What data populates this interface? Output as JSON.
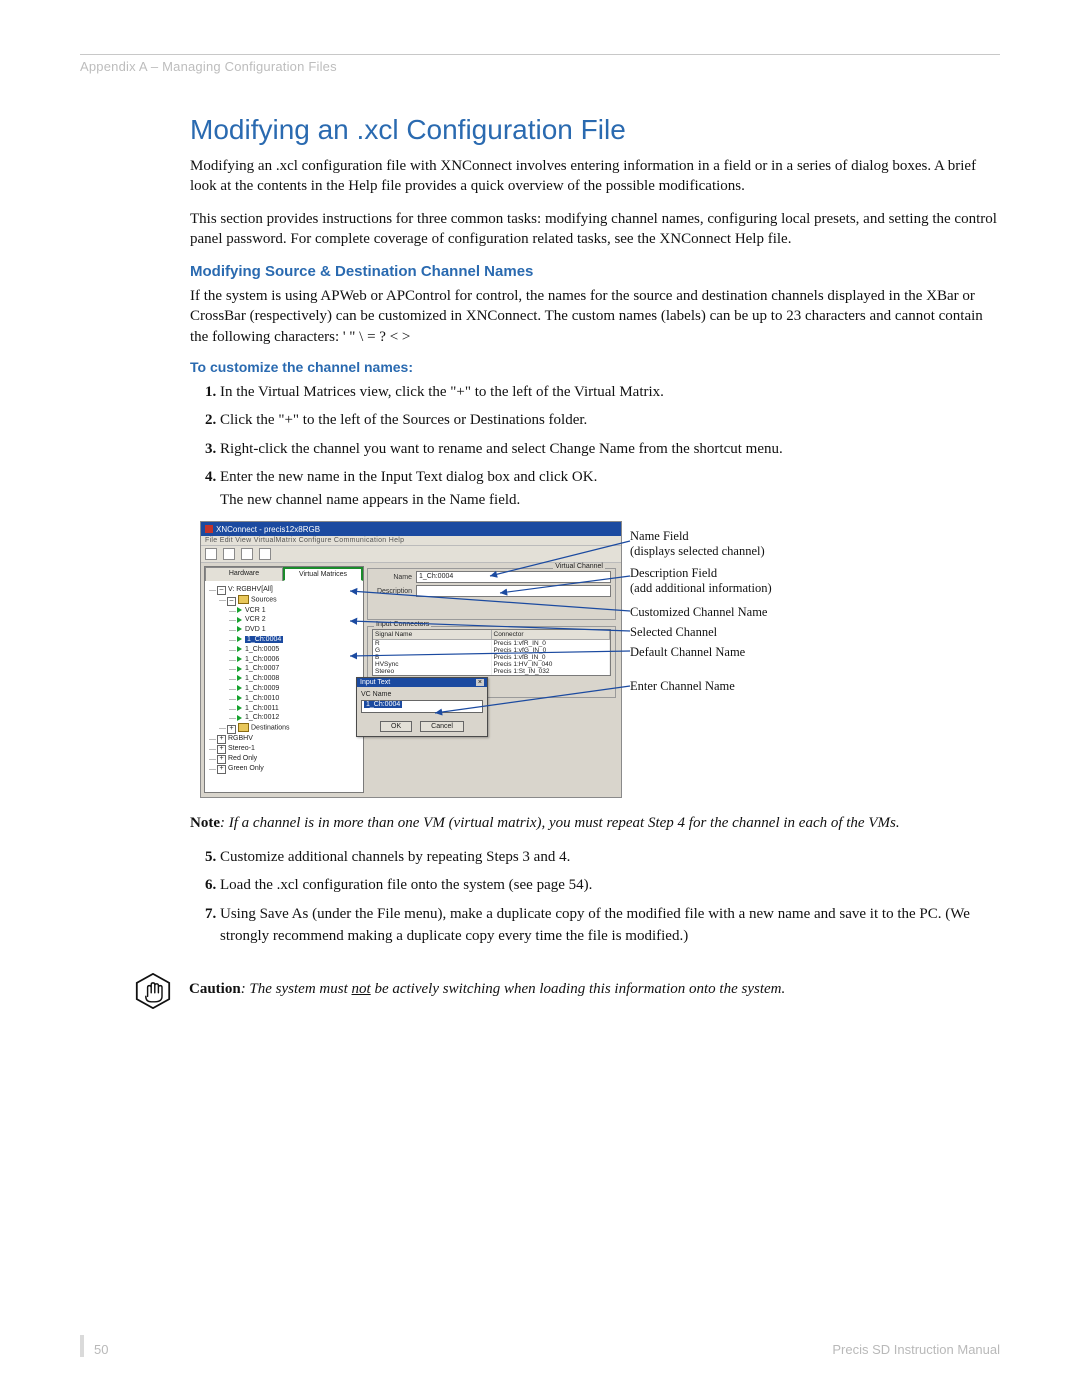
{
  "header": "Appendix A – Managing Configuration Files",
  "title": "Modifying an .xcl Configuration File",
  "para1": "Modifying an .xcl configuration file with XNConnect involves entering information in a field or in a series of dialog boxes. A brief look at the contents in the Help file provides a quick overview of the possible modifications.",
  "para2": "This section provides instructions for three common tasks: modifying channel names, configuring local presets, and setting the control panel password. For complete coverage of configuration related tasks, see the XNConnect Help file.",
  "sub1": "Modifying Source & Destination Channel Names",
  "para3": "If the system is using APWeb or APControl for control, the names for the source and destination channels displayed in the XBar or CrossBar (respectively) can be customized in XNConnect. The custom names (labels) can be up to 23 characters and cannot contain the following characters:  '  \"  \\  =  ?  <  >",
  "sub2": "To customize the channel names:",
  "steps_a": [
    "In the Virtual Matrices view, click the \"+\" to the left of the Virtual Matrix.",
    "Click the \"+\" to the left of the Sources or Destinations folder.",
    "Right-click the channel you want to rename and select Change Name from the shortcut menu.",
    "Enter the new name in the Input Text dialog box and click OK.\nThe new channel name appears in the Name field."
  ],
  "note_label": "Note",
  "note_text": ": If a channel is in more than one VM (virtual matrix), you must repeat Step 4 for the channel in each of the VMs.",
  "steps_b": [
    "Customize additional channels by repeating Steps 3 and 4.",
    "Load the .xcl configuration file onto the system (see page 54).",
    "Using Save As (under the File menu), make a duplicate copy of the modified file with a new name and save it to the PC. (We strongly recommend making a duplicate copy every time the file is modified.)"
  ],
  "caution_label": "Caution",
  "caution_pre": ": The system must ",
  "caution_not": "not",
  "caution_post": " be actively switching when loading this information onto the system.",
  "page_num": "50",
  "footer_right": "Precis SD Instruction Manual",
  "figure": {
    "titlebar": "XNConnect - precis12x8RGB",
    "menubar": "File   Edit   View   VirtualMatrix   Configure   Communication   Help",
    "tab_hardware": "Hardware",
    "tab_vm": "Virtual Matrices",
    "tree": {
      "root": "V: RGBHV[All]",
      "sources": "Sources",
      "items": [
        "VCR 1",
        "VCR 2",
        "DVD 1",
        "1_Ch:0004",
        "1_Ch:0005",
        "1_Ch:0006",
        "1_Ch:0007",
        "1_Ch:0008",
        "1_Ch:0009",
        "1_Ch:0010",
        "1_Ch:0011",
        "1_Ch:0012"
      ],
      "dest": "Destinations",
      "others": [
        "RGBHV",
        "Stereo-1",
        "Red Only",
        "Green Only"
      ]
    },
    "vc_label": "Virtual Channel",
    "name_label": "Name",
    "name_value": "1_Ch:0004",
    "desc_label": "Description",
    "ic_label": "Input Connectors",
    "th_signal": "Signal Name",
    "th_conn": "Connector",
    "rows": [
      [
        "R",
        "Precis 1:vfR_IN_0"
      ],
      [
        "G",
        "Precis 1:vfG_IN_0"
      ],
      [
        "B",
        "Precis 1:vfB_IN_0"
      ],
      [
        "HVSync",
        "Precis 1:HV_IN_040"
      ],
      [
        "Stereo",
        "Precis 1:St_IN_032"
      ]
    ],
    "dialog_title": "Input Text",
    "dialog_label": "VC Name",
    "dialog_value": "1_Ch:0004",
    "ok": "OK",
    "cancel": "Cancel",
    "callouts": [
      {
        "l1": "Name Field",
        "l2": "(displays selected channel)"
      },
      {
        "l1": "Description Field",
        "l2": "(add additional information)"
      },
      {
        "l1": "Customized Channel Name",
        "l2": ""
      },
      {
        "l1": "Selected Channel",
        "l2": ""
      },
      {
        "l1": "Default Channel Name",
        "l2": ""
      },
      {
        "l1": "Enter Channel Name",
        "l2": ""
      }
    ]
  }
}
